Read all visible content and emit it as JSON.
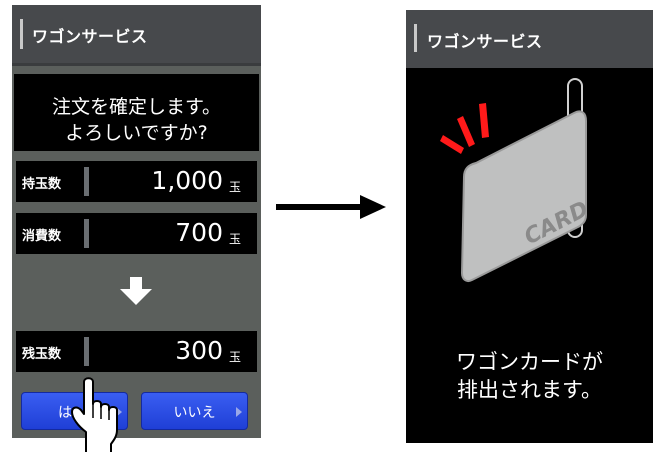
{
  "left_screen": {
    "header_title": "ワゴンサービス",
    "confirm_line1": "注文を確定します。",
    "confirm_line2": "よろしいですか?",
    "rows": [
      {
        "label": "持玉数",
        "value": "1,000",
        "unit": "玉"
      },
      {
        "label": "消費数",
        "value": "700",
        "unit": "玉"
      },
      {
        "label": "残玉数",
        "value": "300",
        "unit": "玉"
      }
    ],
    "buttons": {
      "yes": "は",
      "no": "いいえ"
    }
  },
  "right_screen": {
    "header_title": "ワゴンサービス",
    "card_text": "CARD",
    "message_line1": "ワゴンカードが",
    "message_line2": "排出されます。"
  },
  "colors": {
    "button_blue": "#2a4fe6",
    "screen_gray": "#5b5f5c",
    "alert_red": "#ff1a1a"
  }
}
